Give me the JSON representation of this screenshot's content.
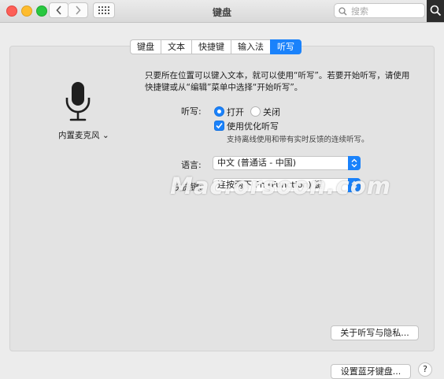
{
  "window": {
    "title": "键盘",
    "search_placeholder": "搜索"
  },
  "tabs": [
    {
      "label": "键盘",
      "active": false
    },
    {
      "label": "文本",
      "active": false
    },
    {
      "label": "快捷键",
      "active": false
    },
    {
      "label": "输入法",
      "active": false
    },
    {
      "label": "听写",
      "active": true
    }
  ],
  "microphone": {
    "label": "内置麦克风 ⌄"
  },
  "dictation": {
    "description": "只要所在位置可以键入文本，就可以使用“听写”。若要开始听写，请使用快捷键或从“编辑”菜单中选择“开始听写”。",
    "label": "听写:",
    "option_on": "打开",
    "option_off": "关闭",
    "selected": "打开",
    "enhanced_label": "使用优化听写",
    "enhanced_checked": true,
    "enhanced_note": "支持离线使用和带有实时反馈的连续听写。"
  },
  "language": {
    "label": "语言:",
    "value": "中文 (普通话 - 中国)"
  },
  "shortcut": {
    "label": "快捷键:",
    "value": "连按两下 Fn (Function) 键"
  },
  "watermark": "Mac.orsoon.com",
  "buttons": {
    "privacy": "关于听写与隐私...",
    "bluetooth": "设置蓝牙键盘...",
    "help": "?"
  },
  "colors": {
    "accent": "#1a82fb",
    "panel": "#e3e3e3",
    "window": "#ececec"
  }
}
